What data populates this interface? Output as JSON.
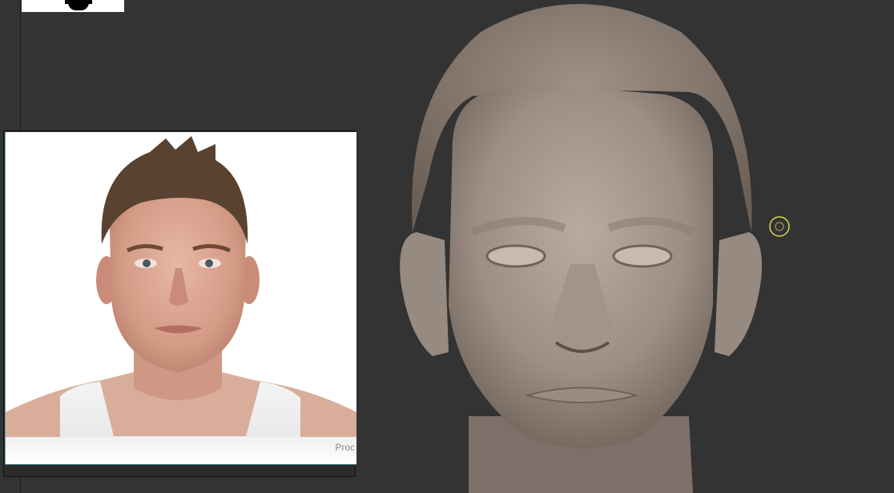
{
  "viewport": {
    "background": "#333333",
    "cursor_icon": "brush-cursor-icon",
    "cursor_color": "#d8d84a"
  },
  "reference_panel": {
    "watermark_text": "Proc",
    "photo_icon": "reference-photo-image"
  },
  "thumbnail": {
    "icon": "navigation-thumbnail-icon"
  },
  "model": {
    "icon": "sculpted-head-model",
    "clay_color": "#a89a8e"
  }
}
